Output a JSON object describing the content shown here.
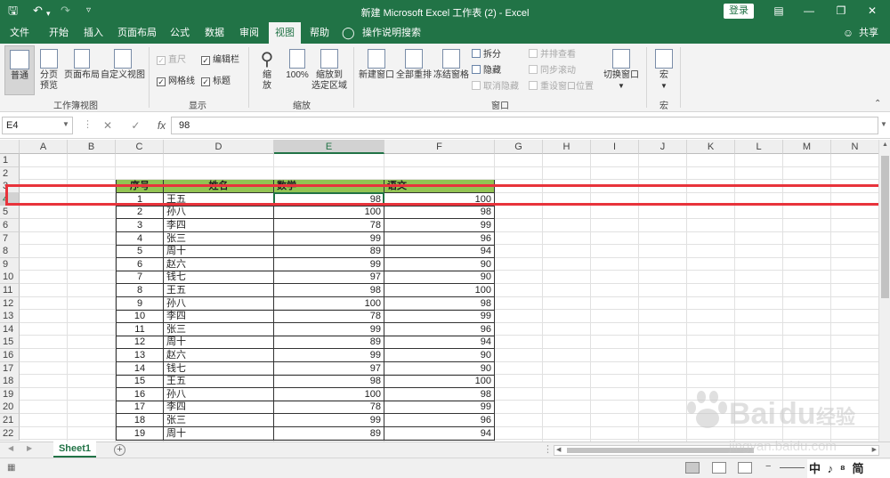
{
  "title_bar": {
    "title": "新建 Microsoft Excel 工作表 (2) - Excel",
    "login_label": "登录",
    "save_icon": "save-icon",
    "undo_icon": "undo-icon",
    "redo_icon": "redo-icon",
    "customize_icon": "customize-icon"
  },
  "menu_tabs": [
    "文件",
    "开始",
    "插入",
    "页面布局",
    "公式",
    "数据",
    "审阅",
    "视图",
    "帮助"
  ],
  "active_tab": "视图",
  "tell_me": "操作说明搜索",
  "share_label": "共享",
  "ribbon": {
    "workbook_views": {
      "group_label": "工作簿视图",
      "normal": "普通",
      "page_break_line1": "分页",
      "page_break_line2": "预览",
      "page_layout": "页面布局",
      "custom_views": "自定义视图"
    },
    "show": {
      "group_label": "显示",
      "ruler": "直尺",
      "gridlines": "网格线",
      "formula_bar": "编辑栏",
      "headings": "标题"
    },
    "zoom": {
      "group_label": "缩放",
      "zoom_line1": "缩",
      "zoom_line2": "放",
      "hundred": "100%",
      "to_selection_line1": "缩放到",
      "to_selection_line2": "选定区域"
    },
    "window": {
      "group_label": "窗口",
      "new_window": "新建窗口",
      "arrange_all": "全部重排",
      "freeze_panes": "冻结窗格",
      "split": "拆分",
      "hide": "隐藏",
      "unhide": "取消隐藏",
      "side_by_side": "并排查看",
      "sync_scroll": "同步滚动",
      "reset_position": "重设窗口位置",
      "switch_windows": "切换窗口"
    },
    "macros": {
      "group_label": "宏",
      "macro": "宏"
    }
  },
  "formula_bar": {
    "name_box": "E4",
    "fx": "fx",
    "value": "98"
  },
  "columns": [
    "A",
    "B",
    "C",
    "D",
    "E",
    "F",
    "G",
    "H",
    "I",
    "J",
    "K",
    "L",
    "M",
    "N"
  ],
  "rows": [
    "1",
    "2",
    "3",
    "4",
    "5",
    "6",
    "7",
    "8",
    "9",
    "10",
    "11",
    "12",
    "13",
    "14",
    "15",
    "16",
    "17",
    "18",
    "19",
    "20",
    "21",
    "22"
  ],
  "table": {
    "header": [
      "序号",
      "姓名",
      "数学",
      "语文"
    ],
    "rows": [
      [
        "1",
        "王五",
        "98",
        "100"
      ],
      [
        "2",
        "孙八",
        "100",
        "98"
      ],
      [
        "3",
        "李四",
        "78",
        "99"
      ],
      [
        "4",
        "张三",
        "99",
        "96"
      ],
      [
        "5",
        "周十",
        "89",
        "94"
      ],
      [
        "6",
        "赵六",
        "99",
        "90"
      ],
      [
        "7",
        "钱七",
        "97",
        "90"
      ],
      [
        "8",
        "王五",
        "98",
        "100"
      ],
      [
        "9",
        "孙八",
        "100",
        "98"
      ],
      [
        "10",
        "李四",
        "78",
        "99"
      ],
      [
        "11",
        "张三",
        "99",
        "96"
      ],
      [
        "12",
        "周十",
        "89",
        "94"
      ],
      [
        "13",
        "赵六",
        "99",
        "90"
      ],
      [
        "14",
        "钱七",
        "97",
        "90"
      ],
      [
        "15",
        "王五",
        "98",
        "100"
      ],
      [
        "16",
        "孙八",
        "100",
        "98"
      ],
      [
        "17",
        "李四",
        "78",
        "99"
      ],
      [
        "18",
        "张三",
        "99",
        "96"
      ],
      [
        "19",
        "周十",
        "89",
        "94"
      ]
    ],
    "header_fill": "#92c353"
  },
  "highlight_color": "#e8333b",
  "accent_color": "#217346",
  "sheet_tab": "Sheet1",
  "ime_text": "中 ♪ ⁸ 简",
  "watermark": {
    "brand": "Bai",
    "brand2": "du",
    "cn": "经验",
    "url": "jingyan.baidu.com"
  }
}
